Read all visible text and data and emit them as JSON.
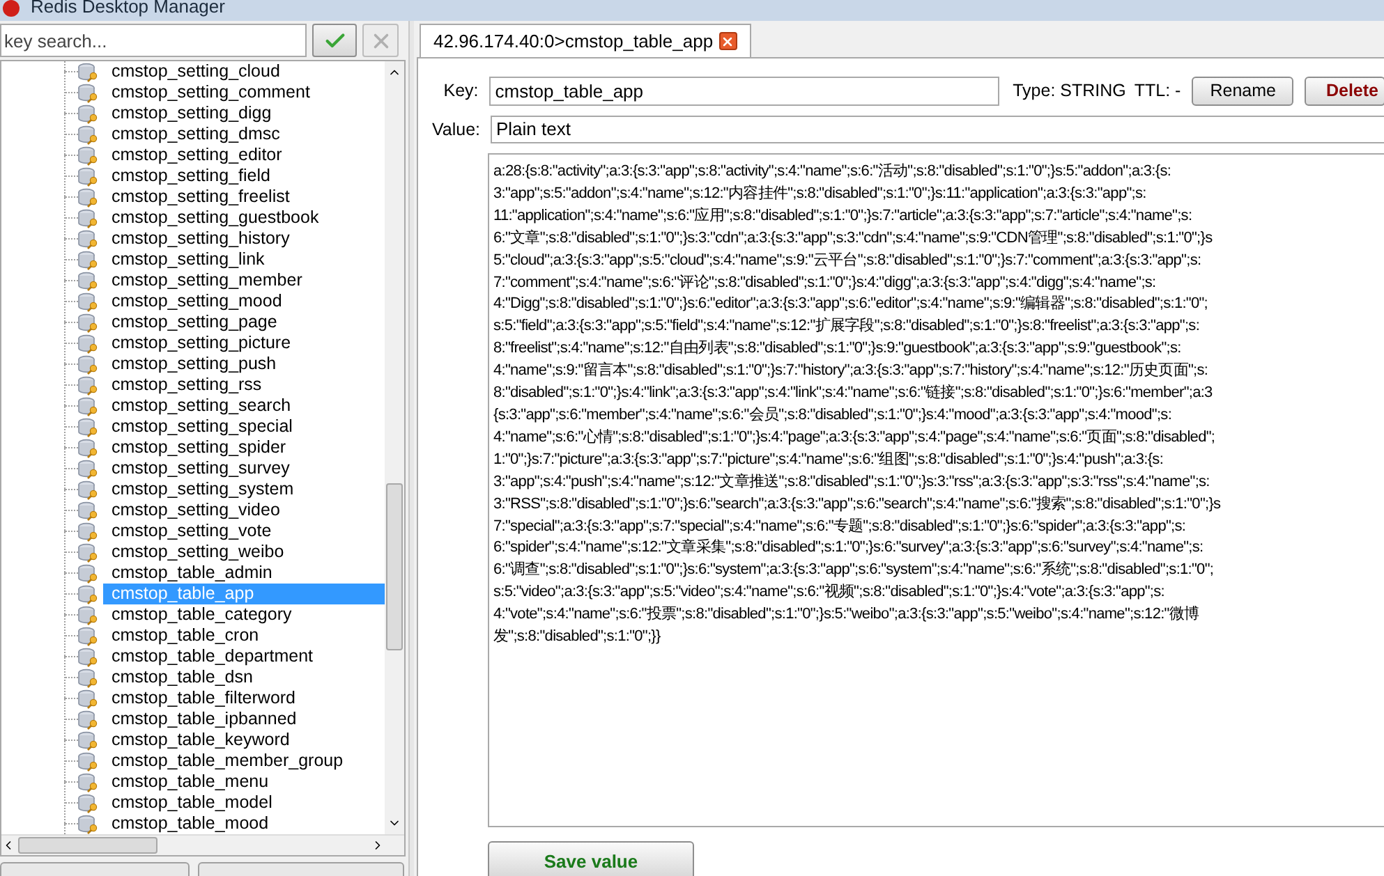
{
  "window": {
    "title": "Redis Desktop Manager"
  },
  "sidebar": {
    "search": {
      "placeholder": "key search..."
    },
    "keys": [
      {
        "label": "cmstop_setting_cloud",
        "selected": false
      },
      {
        "label": "cmstop_setting_comment",
        "selected": false
      },
      {
        "label": "cmstop_setting_digg",
        "selected": false
      },
      {
        "label": "cmstop_setting_dmsc",
        "selected": false
      },
      {
        "label": "cmstop_setting_editor",
        "selected": false
      },
      {
        "label": "cmstop_setting_field",
        "selected": false
      },
      {
        "label": "cmstop_setting_freelist",
        "selected": false
      },
      {
        "label": "cmstop_setting_guestbook",
        "selected": false
      },
      {
        "label": "cmstop_setting_history",
        "selected": false
      },
      {
        "label": "cmstop_setting_link",
        "selected": false
      },
      {
        "label": "cmstop_setting_member",
        "selected": false
      },
      {
        "label": "cmstop_setting_mood",
        "selected": false
      },
      {
        "label": "cmstop_setting_page",
        "selected": false
      },
      {
        "label": "cmstop_setting_picture",
        "selected": false
      },
      {
        "label": "cmstop_setting_push",
        "selected": false
      },
      {
        "label": "cmstop_setting_rss",
        "selected": false
      },
      {
        "label": "cmstop_setting_search",
        "selected": false
      },
      {
        "label": "cmstop_setting_special",
        "selected": false
      },
      {
        "label": "cmstop_setting_spider",
        "selected": false
      },
      {
        "label": "cmstop_setting_survey",
        "selected": false
      },
      {
        "label": "cmstop_setting_system",
        "selected": false
      },
      {
        "label": "cmstop_setting_video",
        "selected": false
      },
      {
        "label": "cmstop_setting_vote",
        "selected": false
      },
      {
        "label": "cmstop_setting_weibo",
        "selected": false
      },
      {
        "label": "cmstop_table_admin",
        "selected": false
      },
      {
        "label": "cmstop_table_app",
        "selected": true
      },
      {
        "label": "cmstop_table_category",
        "selected": false
      },
      {
        "label": "cmstop_table_cron",
        "selected": false
      },
      {
        "label": "cmstop_table_department",
        "selected": false
      },
      {
        "label": "cmstop_table_dsn",
        "selected": false
      },
      {
        "label": "cmstop_table_filterword",
        "selected": false
      },
      {
        "label": "cmstop_table_ipbanned",
        "selected": false
      },
      {
        "label": "cmstop_table_keyword",
        "selected": false
      },
      {
        "label": "cmstop_table_member_group",
        "selected": false
      },
      {
        "label": "cmstop_table_menu",
        "selected": false
      },
      {
        "label": "cmstop_table_model",
        "selected": false
      },
      {
        "label": "cmstop_table_mood",
        "selected": false
      }
    ]
  },
  "tabs": [
    {
      "label": "42.96.174.40:0>cmstop_table_app",
      "selected": true
    }
  ],
  "editor": {
    "key_label": "Key:",
    "key": "cmstop_table_app",
    "type": "Type: STRING",
    "ttl": "TTL: -",
    "rename": "Rename",
    "delete": "Delete",
    "value_label": "Value:",
    "format": "Plain text",
    "value_lines": [
      "a:28:{s:8:\"activity\";a:3:{s:3:\"app\";s:8:\"activity\";s:4:\"name\";s:6:\"活动\";s:8:\"disabled\";s:1:\"0\";}s:5:\"addon\";a:3:{s:",
      "3:\"app\";s:5:\"addon\";s:4:\"name\";s:12:\"内容挂件\";s:8:\"disabled\";s:1:\"0\";}s:11:\"application\";a:3:{s:3:\"app\";s:",
      "11:\"application\";s:4:\"name\";s:6:\"应用\";s:8:\"disabled\";s:1:\"0\";}s:7:\"article\";a:3:{s:3:\"app\";s:7:\"article\";s:4:\"name\";s:",
      "6:\"文章\";s:8:\"disabled\";s:1:\"0\";}s:3:\"cdn\";a:3:{s:3:\"app\";s:3:\"cdn\";s:4:\"name\";s:9:\"CDN管理\";s:8:\"disabled\";s:1:\"0\";}s",
      "5:\"cloud\";a:3:{s:3:\"app\";s:5:\"cloud\";s:4:\"name\";s:9:\"云平台\";s:8:\"disabled\";s:1:\"0\";}s:7:\"comment\";a:3:{s:3:\"app\";s:",
      "7:\"comment\";s:4:\"name\";s:6:\"评论\";s:8:\"disabled\";s:1:\"0\";}s:4:\"digg\";a:3:{s:3:\"app\";s:4:\"digg\";s:4:\"name\";s:",
      "4:\"Digg\";s:8:\"disabled\";s:1:\"0\";}s:6:\"editor\";a:3:{s:3:\"app\";s:6:\"editor\";s:4:\"name\";s:9:\"编辑器\";s:8:\"disabled\";s:1:\"0\";",
      "s:5:\"field\";a:3:{s:3:\"app\";s:5:\"field\";s:4:\"name\";s:12:\"扩展字段\";s:8:\"disabled\";s:1:\"0\";}s:8:\"freelist\";a:3:{s:3:\"app\";s:",
      "8:\"freelist\";s:4:\"name\";s:12:\"自由列表\";s:8:\"disabled\";s:1:\"0\";}s:9:\"guestbook\";a:3:{s:3:\"app\";s:9:\"guestbook\";s:",
      "4:\"name\";s:9:\"留言本\";s:8:\"disabled\";s:1:\"0\";}s:7:\"history\";a:3:{s:3:\"app\";s:7:\"history\";s:4:\"name\";s:12:\"历史页面\";s:",
      "8:\"disabled\";s:1:\"0\";}s:4:\"link\";a:3:{s:3:\"app\";s:4:\"link\";s:4:\"name\";s:6:\"链接\";s:8:\"disabled\";s:1:\"0\";}s:6:\"member\";a:3",
      "{s:3:\"app\";s:6:\"member\";s:4:\"name\";s:6:\"会员\";s:8:\"disabled\";s:1:\"0\";}s:4:\"mood\";a:3:{s:3:\"app\";s:4:\"mood\";s:",
      "4:\"name\";s:6:\"心情\";s:8:\"disabled\";s:1:\"0\";}s:4:\"page\";a:3:{s:3:\"app\";s:4:\"page\";s:4:\"name\";s:6:\"页面\";s:8:\"disabled\";",
      "1:\"0\";}s:7:\"picture\";a:3:{s:3:\"app\";s:7:\"picture\";s:4:\"name\";s:6:\"组图\";s:8:\"disabled\";s:1:\"0\";}s:4:\"push\";a:3:{s:",
      "3:\"app\";s:4:\"push\";s:4:\"name\";s:12:\"文章推送\";s:8:\"disabled\";s:1:\"0\";}s:3:\"rss\";a:3:{s:3:\"app\";s:3:\"rss\";s:4:\"name\";s:",
      "3:\"RSS\";s:8:\"disabled\";s:1:\"0\";}s:6:\"search\";a:3:{s:3:\"app\";s:6:\"search\";s:4:\"name\";s:6:\"搜索\";s:8:\"disabled\";s:1:\"0\";}s",
      "7:\"special\";a:3:{s:3:\"app\";s:7:\"special\";s:4:\"name\";s:6:\"专题\";s:8:\"disabled\";s:1:\"0\";}s:6:\"spider\";a:3:{s:3:\"app\";s:",
      "6:\"spider\";s:4:\"name\";s:12:\"文章采集\";s:8:\"disabled\";s:1:\"0\";}s:6:\"survey\";a:3:{s:3:\"app\";s:6:\"survey\";s:4:\"name\";s:",
      "6:\"调查\";s:8:\"disabled\";s:1:\"0\";}s:6:\"system\";a:3:{s:3:\"app\";s:6:\"system\";s:4:\"name\";s:6:\"系统\";s:8:\"disabled\";s:1:\"0\";",
      "s:5:\"video\";a:3:{s:3:\"app\";s:5:\"video\";s:4:\"name\";s:6:\"视频\";s:8:\"disabled\";s:1:\"0\";}s:4:\"vote\";a:3:{s:3:\"app\";s:",
      "4:\"vote\";s:4:\"name\";s:6:\"投票\";s:8:\"disabled\";s:1:\"0\";}s:5:\"weibo\";a:3:{s:3:\"app\";s:5:\"weibo\";s:4:\"name\";s:12:\"微博",
      "发\";s:8:\"disabled\";s:1:\"0\";}}"
    ],
    "save": "Save value"
  }
}
